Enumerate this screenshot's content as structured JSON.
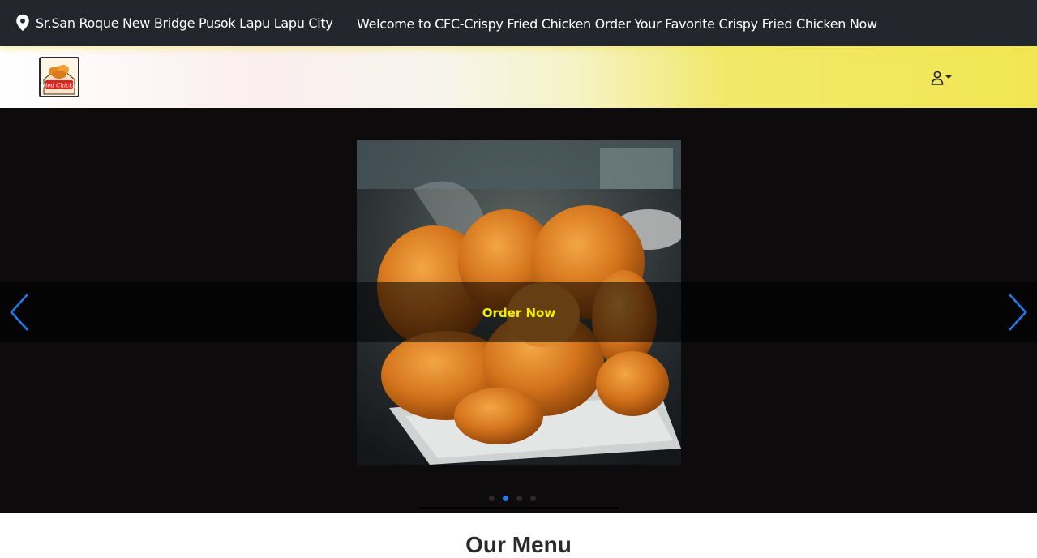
{
  "topbar": {
    "location_icon": "map-pin-icon",
    "location": "Sr.San Roque New Bridge Pusok Lapu Lapu City",
    "welcome": "Welcome to CFC-Crispy Fried Chicken Order Your Favorite Crispy Fried Chicken Now"
  },
  "navbar": {
    "logo_text": "Fried Chicken",
    "user_icon": "user-icon"
  },
  "hero": {
    "cta_label": "Order Now",
    "prev_icon": "chevron-left-icon",
    "next_icon": "chevron-right-icon",
    "slide_count": 4,
    "active_slide": 2
  },
  "menu": {
    "title": "Our Menu"
  },
  "colors": {
    "topbar_bg": "#23262d",
    "accent_yellow": "#f2f000",
    "arrow_blue": "#1f7bea",
    "hero_bg": "#0d0b0c"
  }
}
